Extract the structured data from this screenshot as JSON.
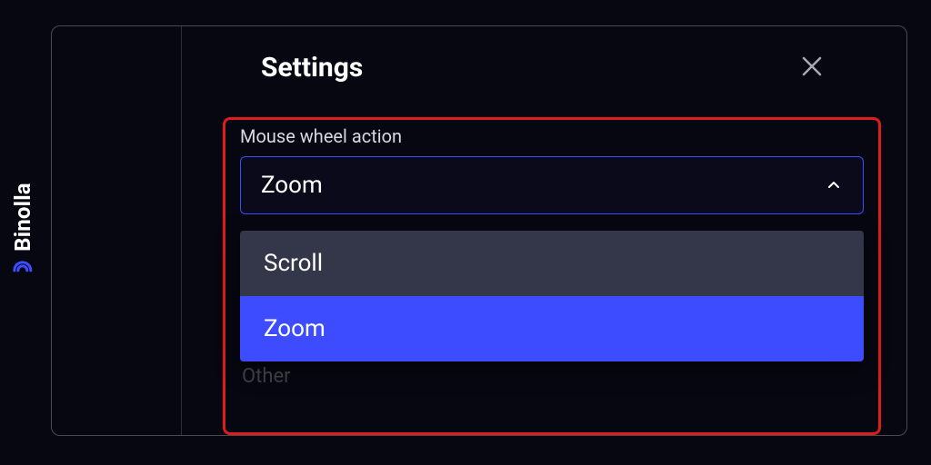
{
  "brand": {
    "name": "Binolla"
  },
  "settings": {
    "title": "Settings",
    "field_label": "Mouse wheel action",
    "selected_value": "Zoom",
    "options": [
      {
        "label": "Scroll"
      },
      {
        "label": "Zoom"
      }
    ],
    "behind_text": "Other"
  }
}
